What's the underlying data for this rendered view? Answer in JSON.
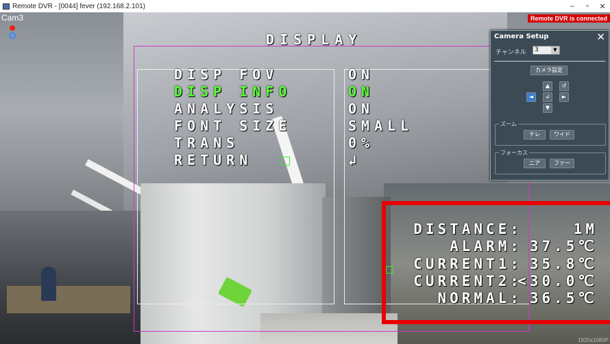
{
  "window": {
    "title": "Remote DVR - [0044] fever (192.168.2.101)",
    "controls": {
      "minimize": "–",
      "maximize": "▫",
      "close": "✕"
    }
  },
  "camera": {
    "label": "Cam3",
    "status": "Remote DVR is connected",
    "resolution": "1920x1080P"
  },
  "osd": {
    "title": "DISPLAY",
    "menu": [
      {
        "label": "DISP FOV",
        "value": "ON",
        "selected": false
      },
      {
        "label": "DISP INFO",
        "value": "ON",
        "selected": true
      },
      {
        "label": "ANALYSIS",
        "value": "ON",
        "selected": false
      },
      {
        "label": "FONT SIZE",
        "value": "SMALL",
        "selected": false
      },
      {
        "label": "TRANS",
        "value": "0%",
        "selected": false
      },
      {
        "label": "RETURN",
        "value": "↲",
        "selected": false
      }
    ],
    "readings": [
      {
        "label": "DISTANCE:",
        "value": "1M"
      },
      {
        "label": "ALARM:",
        "value": "37.5℃"
      },
      {
        "label": "CURRENT1:",
        "value": "35.8℃"
      },
      {
        "label": "CURRENT2:",
        "value": "<30.0℃"
      },
      {
        "label": "NORMAL:",
        "value": "36.5℃"
      }
    ]
  },
  "camera_setup": {
    "title": "Camera Setup",
    "close": "✕",
    "channel_label": "チャンネル",
    "channel_value": "3",
    "camera_settings_button": "カメラ設定",
    "ptz": {
      "up": "▲",
      "rotate": "↺",
      "left": "◄",
      "enter": "↲",
      "right": "►",
      "down": "▼"
    },
    "zoom": {
      "label": "ズーム",
      "tele": "テレ",
      "wide": "ワイド"
    },
    "focus": {
      "label": "フォーカス",
      "near": "ニア",
      "far": "ファー"
    }
  }
}
